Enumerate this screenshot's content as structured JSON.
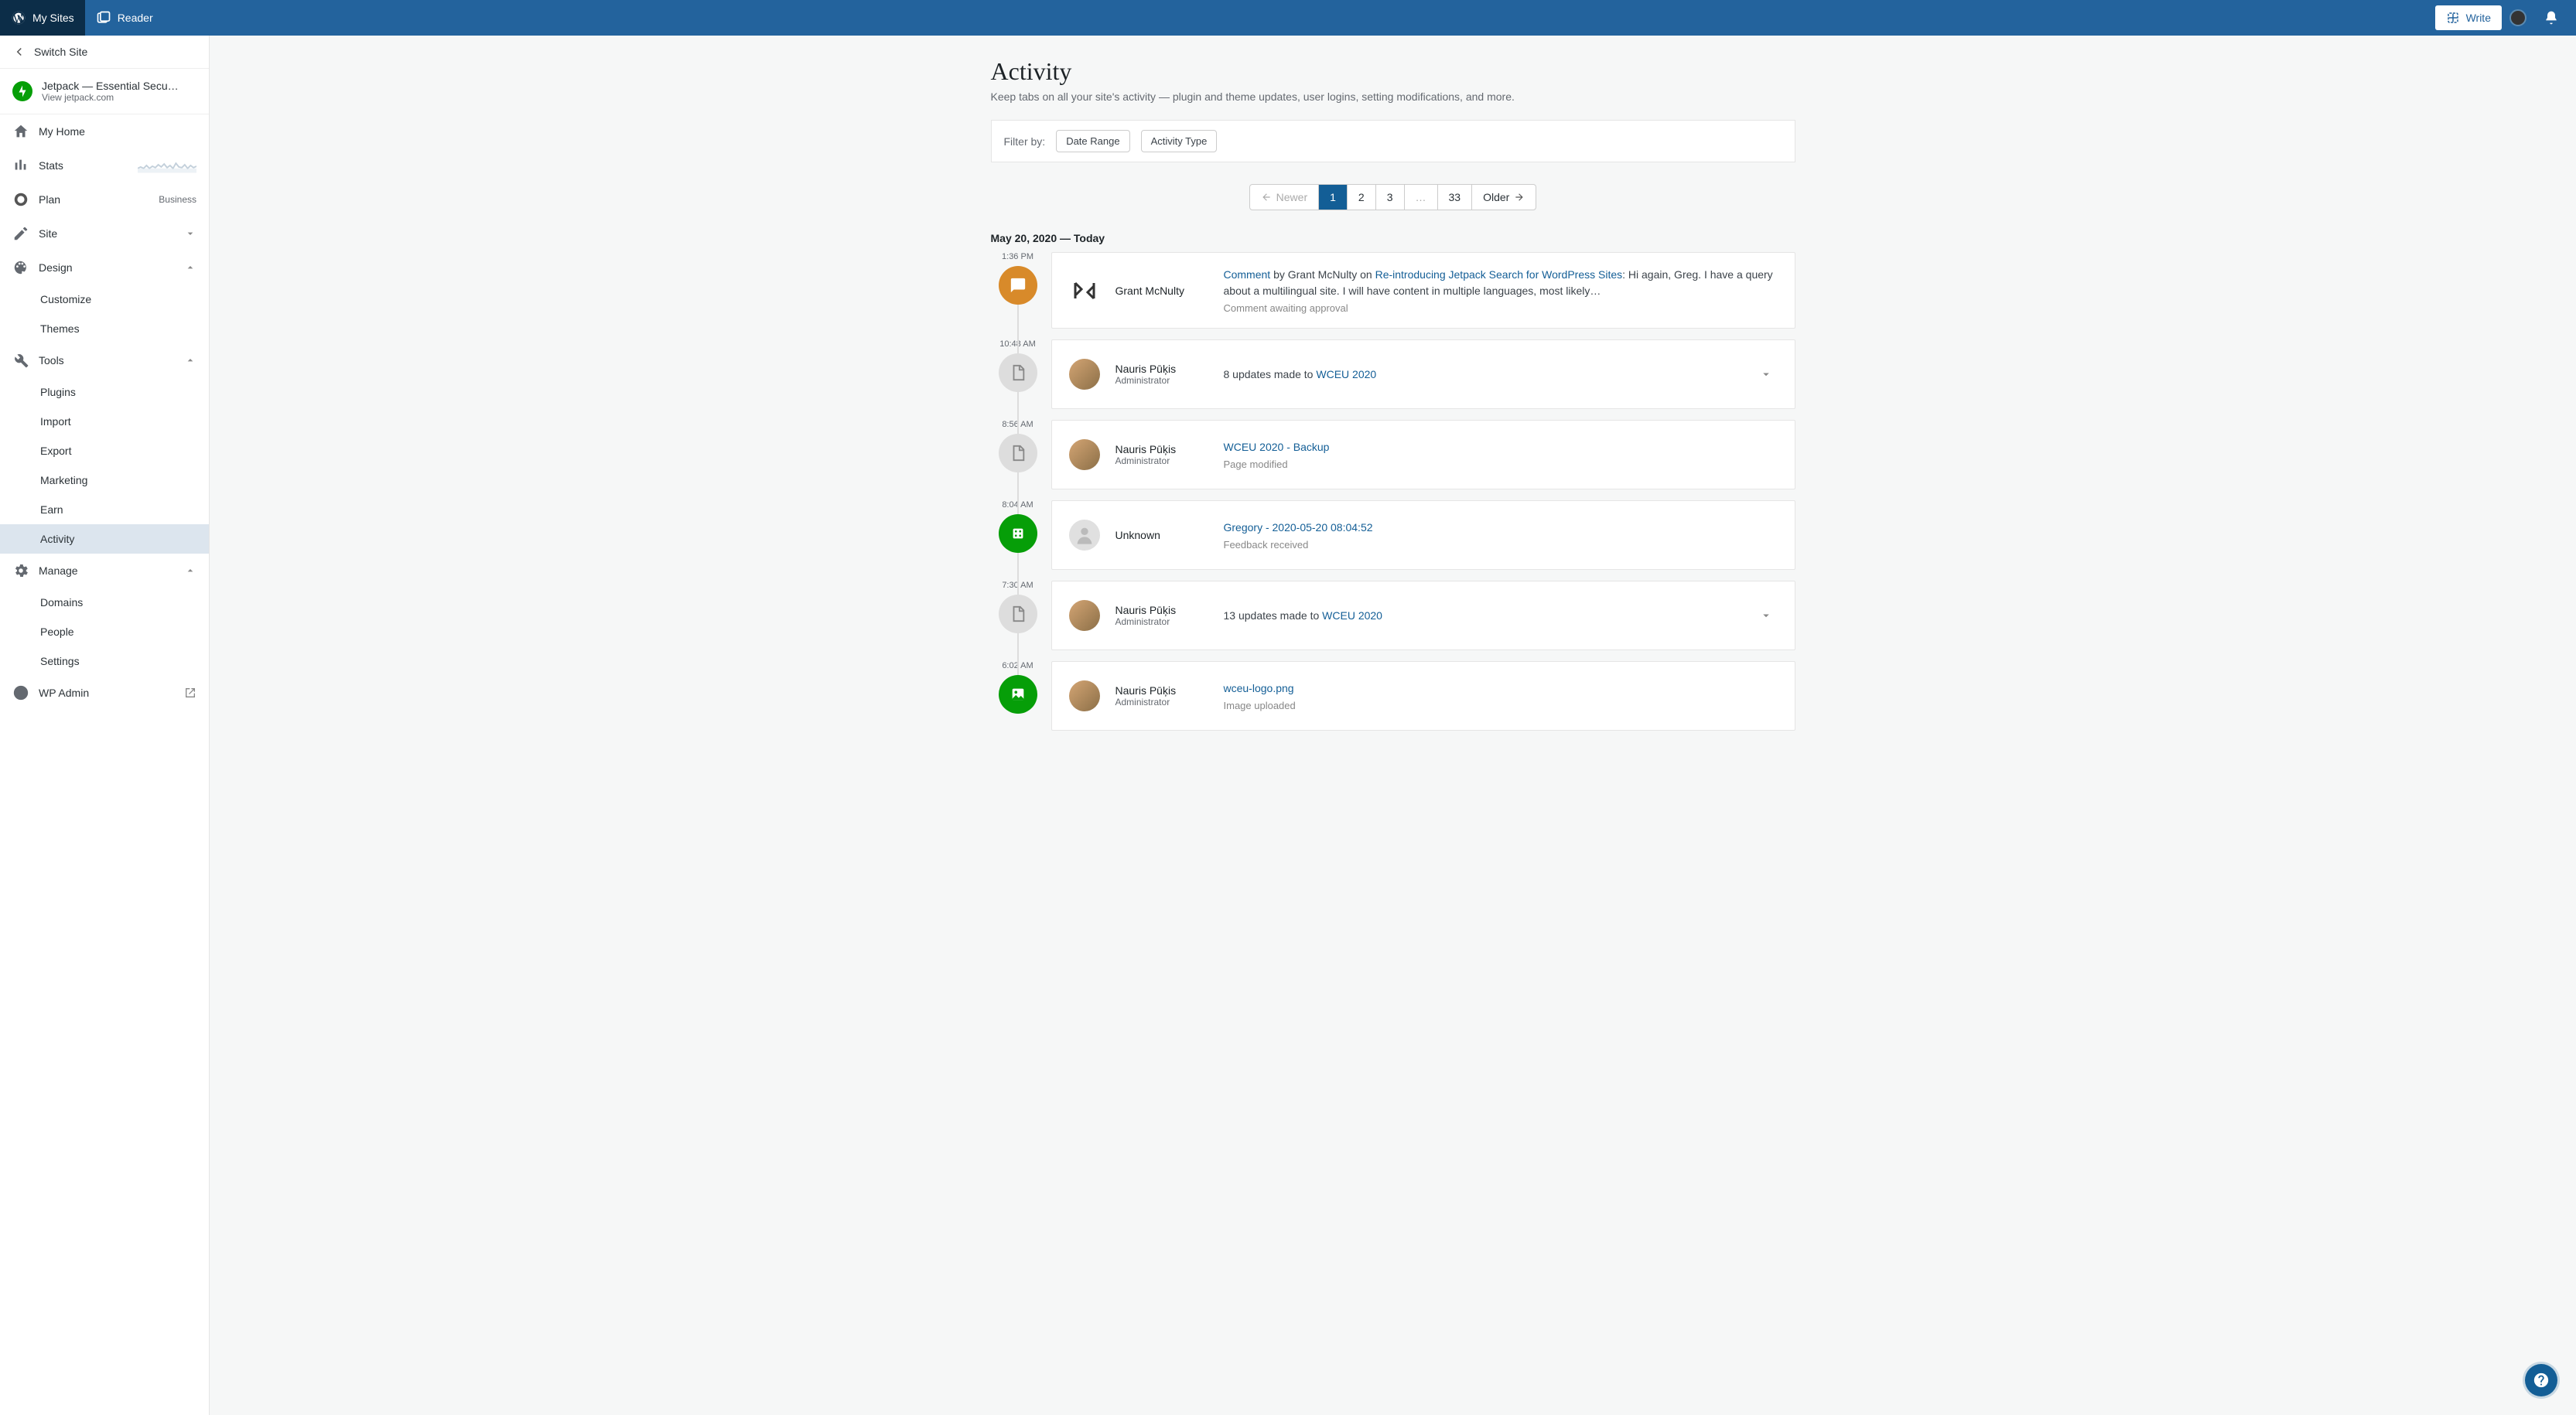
{
  "masterbar": {
    "mysites": "My Sites",
    "reader": "Reader",
    "write": "Write"
  },
  "sidebar": {
    "switch": "Switch Site",
    "site_name": "Jetpack — Essential Security & P",
    "site_url": "View jetpack.com",
    "myhome": "My Home",
    "stats": "Stats",
    "plan": "Plan",
    "plan_badge": "Business",
    "site": "Site",
    "design": "Design",
    "customize": "Customize",
    "themes": "Themes",
    "tools": "Tools",
    "plugins": "Plugins",
    "import": "Import",
    "export": "Export",
    "marketing": "Marketing",
    "earn": "Earn",
    "activity": "Activity",
    "manage": "Manage",
    "domains": "Domains",
    "people": "People",
    "settings": "Settings",
    "wpadmin": "WP Admin"
  },
  "page": {
    "title": "Activity",
    "subtitle": "Keep tabs on all your site's activity — plugin and theme updates, user logins, setting modifications, and more."
  },
  "filters": {
    "label": "Filter by:",
    "daterange": "Date Range",
    "activitytype": "Activity Type"
  },
  "pagination": {
    "newer": "Newer",
    "older": "Older",
    "p1": "1",
    "p2": "2",
    "p3": "3",
    "ellipsis": "…",
    "last": "33"
  },
  "section_heading": "May 20, 2020 — Today",
  "events": {
    "e1": {
      "time": "1:36 PM",
      "actor": "Grant McNulty",
      "link1": "Comment",
      "mid": " by Grant McNulty on ",
      "link2": "Re-introducing Jetpack Search for WordPress Sites",
      "rest": ": Hi again, Greg. I have a query about a multilingual site. I will have content in multiple languages, most likely…",
      "meta": "Comment awaiting approval"
    },
    "e2": {
      "time": "10:48 AM",
      "actor": "Nauris Pūķis",
      "role": "Administrator",
      "text_pre": "8 updates made to ",
      "link": "WCEU 2020"
    },
    "e3": {
      "time": "8:56 AM",
      "actor": "Nauris Pūķis",
      "role": "Administrator",
      "link": "WCEU 2020 - Backup",
      "meta": "Page modified"
    },
    "e4": {
      "time": "8:04 AM",
      "actor": "Unknown",
      "link": "Gregory - 2020-05-20 08:04:52",
      "meta": "Feedback received"
    },
    "e5": {
      "time": "7:30 AM",
      "actor": "Nauris Pūķis",
      "role": "Administrator",
      "text_pre": "13 updates made to ",
      "link": "WCEU 2020"
    },
    "e6": {
      "time": "6:02 AM",
      "actor": "Nauris Pūķis",
      "role": "Administrator",
      "link": "wceu-logo.png",
      "meta": "Image uploaded"
    }
  }
}
